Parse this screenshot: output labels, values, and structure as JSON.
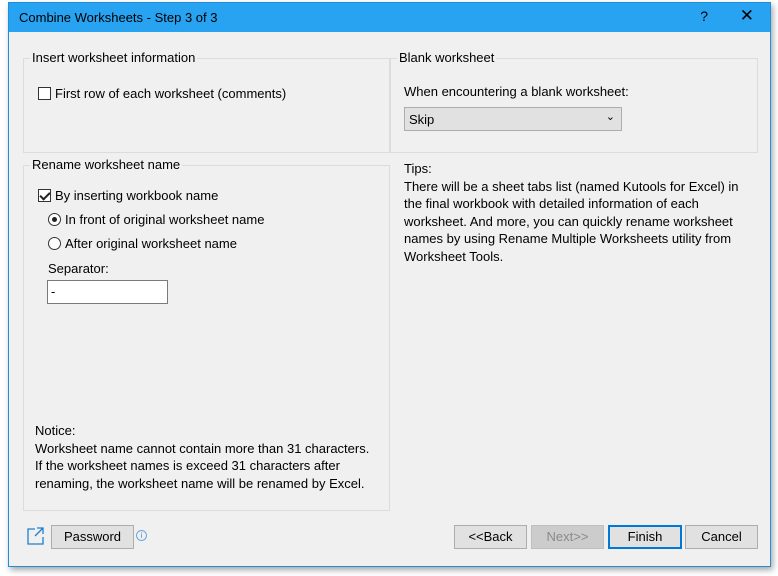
{
  "window": {
    "title": "Combine Worksheets - Step 3 of 3",
    "help": "?",
    "close": "✕"
  },
  "insert_info": {
    "legend": "Insert worksheet information",
    "first_row_label": "First row of each worksheet (comments)",
    "first_row_checked": false
  },
  "blank": {
    "legend": "Blank worksheet",
    "prompt": "When encountering a blank worksheet:",
    "selected": "Skip"
  },
  "rename": {
    "legend": "Rename worksheet name",
    "by_inserting_label": "By inserting workbook name",
    "by_inserting_checked": true,
    "front_label": "In front of original worksheet name",
    "after_label": "After original worksheet name",
    "selected_position": "front",
    "separator_label": "Separator:",
    "separator_value": "-"
  },
  "notice": {
    "title": "Notice:",
    "lines": [
      "Worksheet name cannot contain more than 31 characters.",
      "If the worksheet names is exceed 31 characters after",
      "renaming, the worksheet name will be renamed by Excel."
    ]
  },
  "tips": {
    "title": "Tips:",
    "lines": [
      "There will be a sheet tabs list (named Kutools for Excel) in",
      "the final workbook with detailed information of each",
      "worksheet. And more, you can quickly rename worksheet",
      "names by using Rename Multiple Worksheets utility from",
      "Worksheet Tools."
    ]
  },
  "footer": {
    "password": "Password",
    "back": "<<Back",
    "next": "Next>>",
    "finish": "Finish",
    "cancel": "Cancel"
  },
  "colors": {
    "titlebar": "#27a3f1",
    "focus": "#0078d7"
  }
}
